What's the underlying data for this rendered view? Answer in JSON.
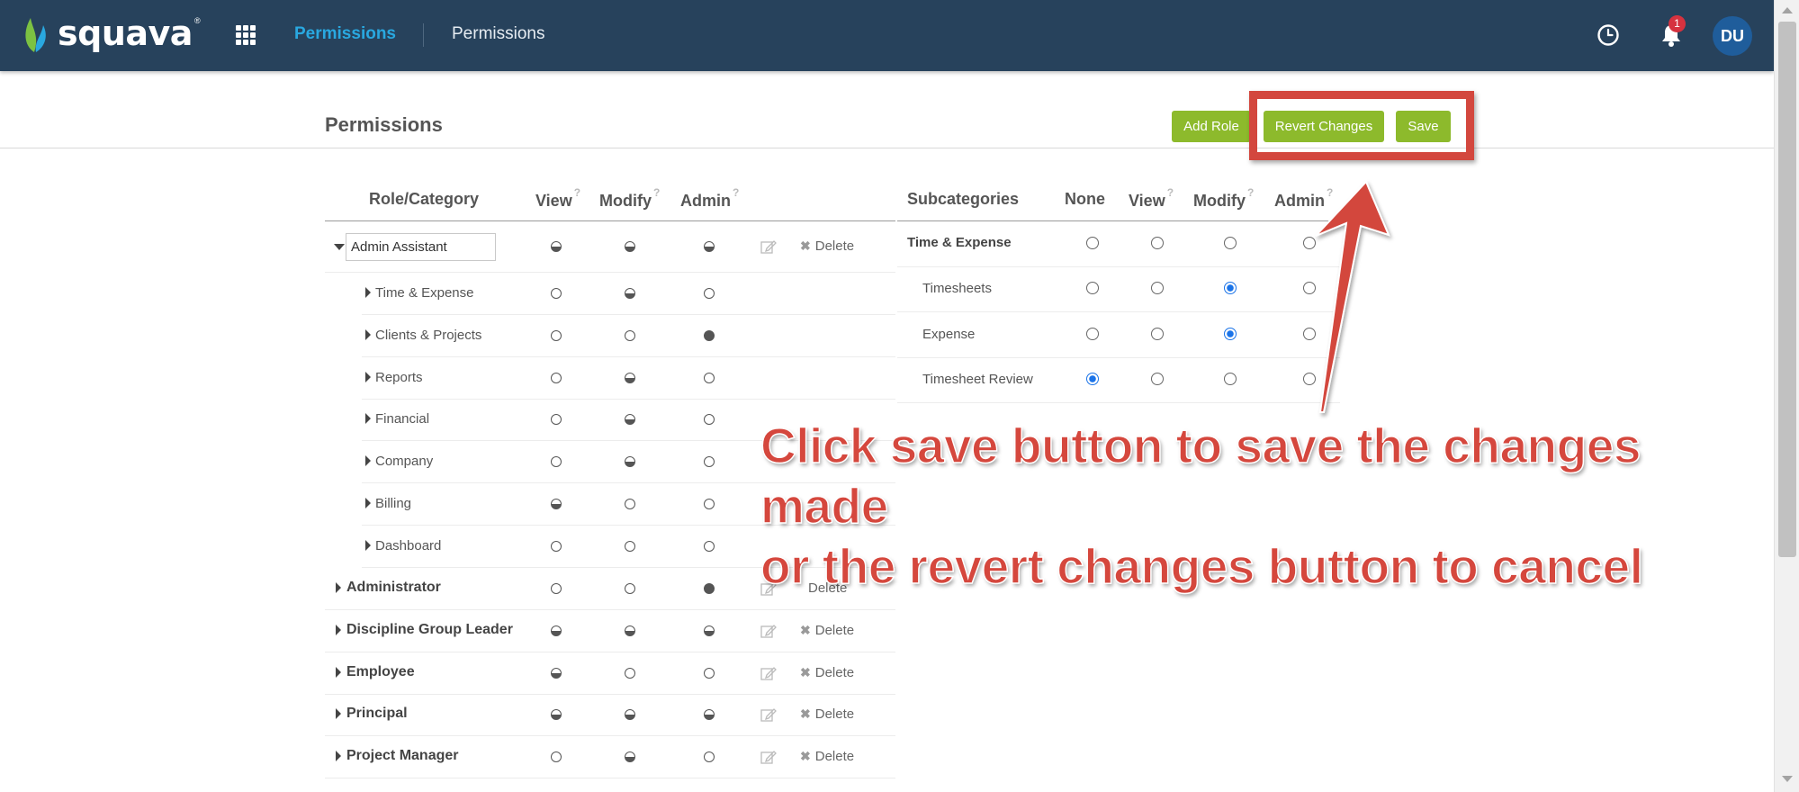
{
  "topbar": {
    "logo_text": "squava",
    "logo_reg": "®",
    "nav_active": "Permissions",
    "nav_crumb": "Permissions",
    "notification_count": "1",
    "avatar_initials": "DU"
  },
  "page": {
    "title": "Permissions",
    "buttons": {
      "add_role": "Add Role",
      "revert": "Revert Changes",
      "save": "Save"
    }
  },
  "left_table": {
    "headers": {
      "role_category": "Role/Category",
      "view": "View",
      "modify": "Modify",
      "admin": "Admin",
      "help": "?"
    },
    "editing_role": "Admin Assistant",
    "delete_label": "Delete",
    "categories": [
      {
        "label": "Time & Expense",
        "view": "empty",
        "modify": "partial",
        "admin": "empty"
      },
      {
        "label": "Clients & Projects",
        "view": "empty",
        "modify": "empty",
        "admin": "full"
      },
      {
        "label": "Reports",
        "view": "empty",
        "modify": "partial",
        "admin": "empty"
      },
      {
        "label": "Financial",
        "view": "empty",
        "modify": "partial",
        "admin": "empty"
      },
      {
        "label": "Company",
        "view": "empty",
        "modify": "partial",
        "admin": "empty"
      },
      {
        "label": "Billing",
        "view": "partial",
        "modify": "empty",
        "admin": "empty"
      },
      {
        "label": "Dashboard",
        "view": "empty",
        "modify": "empty",
        "admin": "empty"
      }
    ],
    "roles": [
      {
        "label": "Administrator",
        "view": "empty",
        "modify": "empty",
        "admin": "full",
        "deletable": false
      },
      {
        "label": "Discipline Group Leader",
        "view": "partial",
        "modify": "partial",
        "admin": "partial",
        "deletable": true
      },
      {
        "label": "Employee",
        "view": "partial",
        "modify": "empty",
        "admin": "empty",
        "deletable": true
      },
      {
        "label": "Principal",
        "view": "partial",
        "modify": "partial",
        "admin": "partial",
        "deletable": true
      },
      {
        "label": "Project Manager",
        "view": "empty",
        "modify": "partial",
        "admin": "empty",
        "deletable": true
      }
    ],
    "editing_role_levels": {
      "view": "partial",
      "modify": "partial",
      "admin": "partial"
    }
  },
  "right_table": {
    "headers": {
      "subcategories": "Subcategories",
      "none": "None",
      "view": "View",
      "modify": "Modify",
      "admin": "Admin"
    },
    "parent": {
      "label": "Time & Expense",
      "selected": ""
    },
    "rows": [
      {
        "label": "Timesheets",
        "selected": "modify"
      },
      {
        "label": "Expense",
        "selected": "modify"
      },
      {
        "label": "Timesheet Review",
        "selected": "none"
      }
    ]
  },
  "annotation": {
    "line1": "Click save button to save the changes made",
    "line2": "or the revert changes button to cancel",
    "color": "#d5473d"
  }
}
